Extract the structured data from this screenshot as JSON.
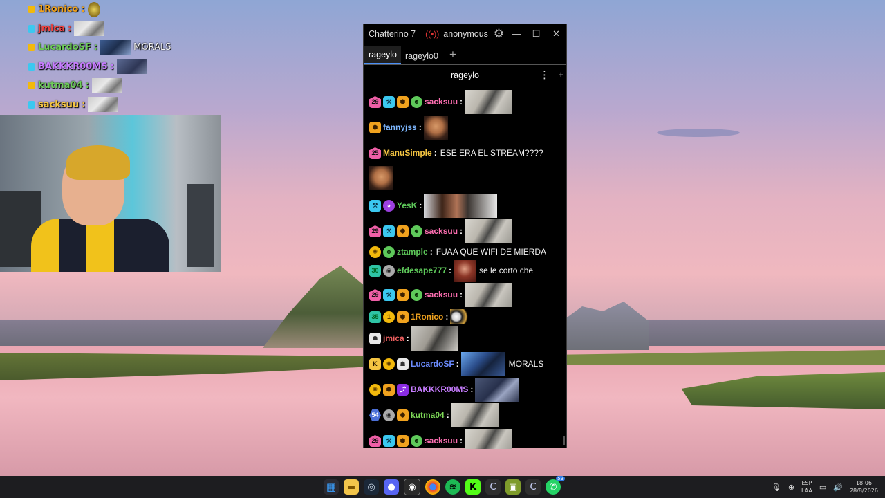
{
  "overlay_chat": [
    {
      "user": "1Ronico",
      "color": "#f0a21e",
      "msg": "",
      "emote": "glass"
    },
    {
      "user": "jmica",
      "color": "#ef4444",
      "msg": "",
      "emote": "kek"
    },
    {
      "user": "LucardoSF",
      "color": "#6ecb5a",
      "msg": "MORALS",
      "emote": "face"
    },
    {
      "user": "BAKKKR00MS",
      "color": "#c77dff",
      "msg": "",
      "emote": "dark"
    },
    {
      "user": "kutma04",
      "color": "#6ecb5a",
      "msg": "",
      "emote": "kek"
    },
    {
      "user": "sacksuu",
      "color": "#f5c542",
      "msg": "",
      "emote": "kek"
    }
  ],
  "window": {
    "app_title": "Chatterino 7",
    "live_icon": "broadcast-icon",
    "account": "anonymous",
    "tabs": [
      "rageylo",
      "rageylo0"
    ],
    "channel": "rageylo",
    "more_glyph": "⋮",
    "plus_glyph": "+"
  },
  "messages": [
    {
      "user": "sacksuu",
      "color": "#ff6fb2",
      "badges": [
        "29",
        "mod",
        "prime",
        "alien"
      ],
      "text": "",
      "emote": "kek"
    },
    {
      "user": "fannyjss",
      "color": "#7db7ff",
      "badges": [
        "prime"
      ],
      "text": "",
      "emote": "face"
    },
    {
      "user": "ManuSimple",
      "color": "#f5c542",
      "badges": [
        "25"
      ],
      "text": "ESE ERA EL STREAM????",
      "emote": "face"
    },
    {
      "user": "YesK",
      "color": "#5ec95a",
      "badges": [
        "mod",
        "purple"
      ],
      "text": "",
      "emote": "wide"
    },
    {
      "user": "sacksuu",
      "color": "#ff6fb2",
      "badges": [
        "29",
        "mod",
        "prime",
        "alien"
      ],
      "text": "",
      "emote": "kek"
    },
    {
      "user": "ztample",
      "color": "#5ec95a",
      "badges": [
        "coin",
        "alien"
      ],
      "text": "FUAA QUE WIFI DE MIERDA",
      "emote": ""
    },
    {
      "user": "efdesape777",
      "color": "#5ec95a",
      "badges": [
        "30",
        "gray"
      ],
      "text": "se le corto che",
      "emote": "red"
    },
    {
      "user": "sacksuu",
      "color": "#ff6fb2",
      "badges": [
        "29",
        "mod",
        "prime",
        "alien"
      ],
      "text": "",
      "emote": "kek"
    },
    {
      "user": "1Ronico",
      "color": "#f0a21e",
      "badges": [
        "35",
        "1",
        "prime"
      ],
      "text": "",
      "emote": "glass"
    },
    {
      "user": "jmica",
      "color": "#ef6060",
      "badges": [
        "white"
      ],
      "text": "",
      "emote": "jm"
    },
    {
      "user": "LucardoSF",
      "color": "#6c8cff",
      "badges": [
        "k",
        "coin",
        "white"
      ],
      "text": "MORALS",
      "emote": "morals"
    },
    {
      "user": "BAKKKR00MS",
      "color": "#c77dff",
      "badges": [
        "coin",
        "prime",
        "hype"
      ],
      "text": "",
      "emote": "bak"
    },
    {
      "user": "kutma04",
      "color": "#7ed957",
      "badges": [
        "54",
        "gray",
        "prime"
      ],
      "text": "",
      "emote": "kek"
    },
    {
      "user": "sacksuu",
      "color": "#ff6fb2",
      "badges": [
        "29",
        "mod",
        "prime",
        "alien"
      ],
      "text": "",
      "emote": "kek"
    }
  ],
  "taskbar": {
    "apps": [
      "windows-start-icon",
      "file-explorer-icon",
      "steam-icon",
      "discord-icon",
      "obs-icon",
      "chrome-icon",
      "spotify-icon",
      "kick-icon",
      "chatterino-icon",
      "game-icon",
      "chatterino-icon-2",
      "whatsapp-icon"
    ],
    "whatsapp_badge": "59",
    "lang_top": "ESP",
    "lang_bottom": "LAA",
    "time": "18:06",
    "date": "28/8/2026"
  }
}
